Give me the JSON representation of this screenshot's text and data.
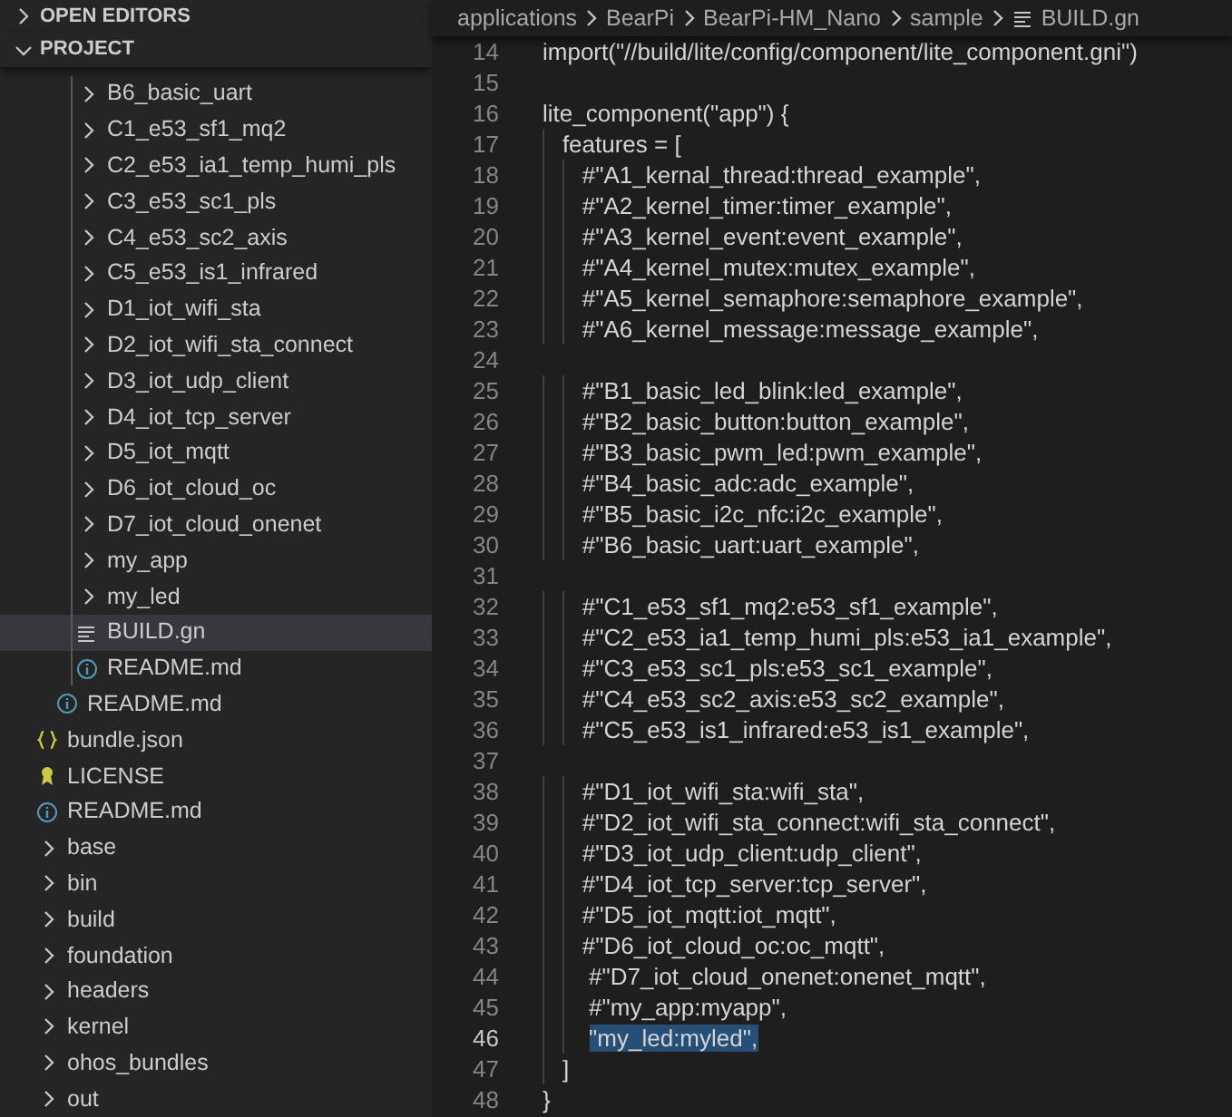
{
  "sidebar": {
    "sections": [
      {
        "title": "OPEN EDITORS",
        "expanded": false
      },
      {
        "title": "PROJECT",
        "expanded": true
      }
    ],
    "tree": [
      {
        "children": [
          {
            "children": [
              {
                "label": "B6_basic_uart",
                "kind": "folder",
                "selected": false
              },
              {
                "label": "C1_e53_sf1_mq2",
                "kind": "folder",
                "selected": false
              },
              {
                "label": "C2_e53_ia1_temp_humi_pls",
                "kind": "folder",
                "selected": false
              },
              {
                "label": "C3_e53_sc1_pls",
                "kind": "folder",
                "selected": false
              },
              {
                "label": "C4_e53_sc2_axis",
                "kind": "folder",
                "selected": false
              },
              {
                "label": "C5_e53_is1_infrared",
                "kind": "folder",
                "selected": false
              },
              {
                "label": "D1_iot_wifi_sta",
                "kind": "folder",
                "selected": false
              },
              {
                "label": "D2_iot_wifi_sta_connect",
                "kind": "folder",
                "selected": false
              },
              {
                "label": "D3_iot_udp_client",
                "kind": "folder",
                "selected": false
              },
              {
                "label": "D4_iot_tcp_server",
                "kind": "folder",
                "selected": false
              },
              {
                "label": "D5_iot_mqtt",
                "kind": "folder",
                "selected": false
              },
              {
                "label": "D6_iot_cloud_oc",
                "kind": "folder",
                "selected": false
              },
              {
                "label": "D7_iot_cloud_onenet",
                "kind": "folder",
                "selected": false
              },
              {
                "label": "my_app",
                "kind": "folder",
                "selected": false
              },
              {
                "label": "my_led",
                "kind": "folder",
                "selected": false
              },
              {
                "label": "BUILD.gn",
                "kind": "text-file",
                "selected": true
              },
              {
                "label": "README.md",
                "kind": "info-file",
                "selected": false
              }
            ]
          },
          {
            "label": "README.md",
            "kind": "info-file",
            "selected": false
          }
        ]
      },
      {
        "label": "bundle.json",
        "kind": "json-file",
        "selected": false
      },
      {
        "label": "LICENSE",
        "kind": "license-file",
        "selected": false
      },
      {
        "label": "README.md",
        "kind": "info-file",
        "selected": false
      },
      {
        "label": "base",
        "kind": "folder",
        "selected": false
      },
      {
        "label": "bin",
        "kind": "folder",
        "selected": false
      },
      {
        "label": "build",
        "kind": "folder",
        "selected": false
      },
      {
        "label": "foundation",
        "kind": "folder",
        "selected": false
      },
      {
        "label": "headers",
        "kind": "folder",
        "selected": false
      },
      {
        "label": "kernel",
        "kind": "folder",
        "selected": false
      },
      {
        "label": "ohos_bundles",
        "kind": "folder",
        "selected": false
      },
      {
        "label": "out",
        "kind": "folder",
        "selected": false
      }
    ]
  },
  "breadcrumb": [
    "applications",
    "BearPi",
    "BearPi-HM_Nano",
    "sample",
    "BUILD.gn"
  ],
  "code": [
    {
      "number": "14",
      "text": "import(\"//build/lite/config/component/lite_component.gni\")",
      "selected": false
    },
    {
      "number": "15",
      "selected": false
    },
    {
      "number": "16",
      "text": "lite_component(\"app\") {",
      "selected": false
    },
    {
      "number": "17",
      "text": "   features = [",
      "selected": false
    },
    {
      "number": "18",
      "text": "      #\"A1_kernal_thread:thread_example\",",
      "selected": false
    },
    {
      "number": "19",
      "text": "      #\"A2_kernel_timer:timer_example\",",
      "selected": false
    },
    {
      "number": "20",
      "text": "      #\"A3_kernel_event:event_example\",",
      "selected": false
    },
    {
      "number": "21",
      "text": "      #\"A4_kernel_mutex:mutex_example\",",
      "selected": false
    },
    {
      "number": "22",
      "text": "      #\"A5_kernel_semaphore:semaphore_example\",",
      "selected": false
    },
    {
      "number": "23",
      "text": "      #\"A6_kernel_message:message_example\",",
      "selected": false
    },
    {
      "number": "24",
      "selected": false
    },
    {
      "number": "25",
      "text": "      #\"B1_basic_led_blink:led_example\",",
      "selected": false
    },
    {
      "number": "26",
      "text": "      #\"B2_basic_button:button_example\",",
      "selected": false
    },
    {
      "number": "27",
      "text": "      #\"B3_basic_pwm_led:pwm_example\",",
      "selected": false
    },
    {
      "number": "28",
      "text": "      #\"B4_basic_adc:adc_example\",",
      "selected": false
    },
    {
      "number": "29",
      "text": "      #\"B5_basic_i2c_nfc:i2c_example\",",
      "selected": false
    },
    {
      "number": "30",
      "text": "      #\"B6_basic_uart:uart_example\",",
      "selected": false
    },
    {
      "number": "31",
      "selected": false
    },
    {
      "number": "32",
      "text": "      #\"C1_e53_sf1_mq2:e53_sf1_example\",",
      "selected": false
    },
    {
      "number": "33",
      "text": "      #\"C2_e53_ia1_temp_humi_pls:e53_ia1_example\",",
      "selected": false
    },
    {
      "number": "34",
      "text": "      #\"C3_e53_sc1_pls:e53_sc1_example\",",
      "selected": false
    },
    {
      "number": "35",
      "text": "      #\"C4_e53_sc2_axis:e53_sc2_example\",",
      "selected": false
    },
    {
      "number": "36",
      "text": "      #\"C5_e53_is1_infrared:e53_is1_example\",",
      "selected": false
    },
    {
      "number": "37",
      "selected": false
    },
    {
      "number": "38",
      "text": "      #\"D1_iot_wifi_sta:wifi_sta\",",
      "selected": false
    },
    {
      "number": "39",
      "text": "      #\"D2_iot_wifi_sta_connect:wifi_sta_connect\",",
      "selected": false
    },
    {
      "number": "40",
      "text": "      #\"D3_iot_udp_client:udp_client\",",
      "selected": false
    },
    {
      "number": "41",
      "text": "      #\"D4_iot_tcp_server:tcp_server\",",
      "selected": false
    },
    {
      "number": "42",
      "text": "      #\"D5_iot_mqtt:iot_mqtt\",",
      "selected": false
    },
    {
      "number": "43",
      "text": "      #\"D6_iot_cloud_oc:oc_mqtt\",",
      "selected": false
    },
    {
      "number": "44",
      "text": "       #\"D7_iot_cloud_onenet:onenet_mqtt\",",
      "selected": false
    },
    {
      "number": "45",
      "text": "       #\"my_app:myapp\",",
      "selected": false
    },
    {
      "number": "46",
      "text": "       \"my_led:myled\",",
      "selected": true
    },
    {
      "number": "47",
      "text": "   ]",
      "selected": false
    },
    {
      "number": "48",
      "text": "}",
      "selected": false
    }
  ]
}
